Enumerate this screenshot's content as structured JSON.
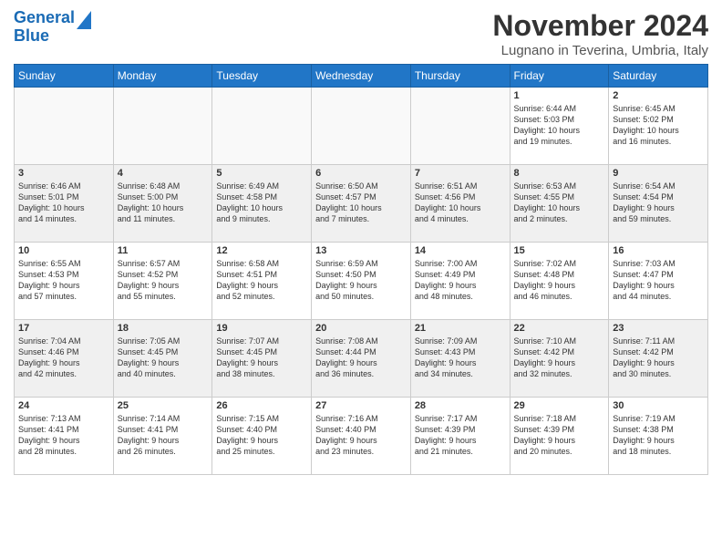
{
  "logo": {
    "line1": "General",
    "line2": "Blue"
  },
  "header": {
    "month": "November 2024",
    "location": "Lugnano in Teverina, Umbria, Italy"
  },
  "weekdays": [
    "Sunday",
    "Monday",
    "Tuesday",
    "Wednesday",
    "Thursday",
    "Friday",
    "Saturday"
  ],
  "weeks": [
    [
      {
        "day": "",
        "content": ""
      },
      {
        "day": "",
        "content": ""
      },
      {
        "day": "",
        "content": ""
      },
      {
        "day": "",
        "content": ""
      },
      {
        "day": "",
        "content": ""
      },
      {
        "day": "1",
        "content": "Sunrise: 6:44 AM\nSunset: 5:03 PM\nDaylight: 10 hours\nand 19 minutes."
      },
      {
        "day": "2",
        "content": "Sunrise: 6:45 AM\nSunset: 5:02 PM\nDaylight: 10 hours\nand 16 minutes."
      }
    ],
    [
      {
        "day": "3",
        "content": "Sunrise: 6:46 AM\nSunset: 5:01 PM\nDaylight: 10 hours\nand 14 minutes."
      },
      {
        "day": "4",
        "content": "Sunrise: 6:48 AM\nSunset: 5:00 PM\nDaylight: 10 hours\nand 11 minutes."
      },
      {
        "day": "5",
        "content": "Sunrise: 6:49 AM\nSunset: 4:58 PM\nDaylight: 10 hours\nand 9 minutes."
      },
      {
        "day": "6",
        "content": "Sunrise: 6:50 AM\nSunset: 4:57 PM\nDaylight: 10 hours\nand 7 minutes."
      },
      {
        "day": "7",
        "content": "Sunrise: 6:51 AM\nSunset: 4:56 PM\nDaylight: 10 hours\nand 4 minutes."
      },
      {
        "day": "8",
        "content": "Sunrise: 6:53 AM\nSunset: 4:55 PM\nDaylight: 10 hours\nand 2 minutes."
      },
      {
        "day": "9",
        "content": "Sunrise: 6:54 AM\nSunset: 4:54 PM\nDaylight: 9 hours\nand 59 minutes."
      }
    ],
    [
      {
        "day": "10",
        "content": "Sunrise: 6:55 AM\nSunset: 4:53 PM\nDaylight: 9 hours\nand 57 minutes."
      },
      {
        "day": "11",
        "content": "Sunrise: 6:57 AM\nSunset: 4:52 PM\nDaylight: 9 hours\nand 55 minutes."
      },
      {
        "day": "12",
        "content": "Sunrise: 6:58 AM\nSunset: 4:51 PM\nDaylight: 9 hours\nand 52 minutes."
      },
      {
        "day": "13",
        "content": "Sunrise: 6:59 AM\nSunset: 4:50 PM\nDaylight: 9 hours\nand 50 minutes."
      },
      {
        "day": "14",
        "content": "Sunrise: 7:00 AM\nSunset: 4:49 PM\nDaylight: 9 hours\nand 48 minutes."
      },
      {
        "day": "15",
        "content": "Sunrise: 7:02 AM\nSunset: 4:48 PM\nDaylight: 9 hours\nand 46 minutes."
      },
      {
        "day": "16",
        "content": "Sunrise: 7:03 AM\nSunset: 4:47 PM\nDaylight: 9 hours\nand 44 minutes."
      }
    ],
    [
      {
        "day": "17",
        "content": "Sunrise: 7:04 AM\nSunset: 4:46 PM\nDaylight: 9 hours\nand 42 minutes."
      },
      {
        "day": "18",
        "content": "Sunrise: 7:05 AM\nSunset: 4:45 PM\nDaylight: 9 hours\nand 40 minutes."
      },
      {
        "day": "19",
        "content": "Sunrise: 7:07 AM\nSunset: 4:45 PM\nDaylight: 9 hours\nand 38 minutes."
      },
      {
        "day": "20",
        "content": "Sunrise: 7:08 AM\nSunset: 4:44 PM\nDaylight: 9 hours\nand 36 minutes."
      },
      {
        "day": "21",
        "content": "Sunrise: 7:09 AM\nSunset: 4:43 PM\nDaylight: 9 hours\nand 34 minutes."
      },
      {
        "day": "22",
        "content": "Sunrise: 7:10 AM\nSunset: 4:42 PM\nDaylight: 9 hours\nand 32 minutes."
      },
      {
        "day": "23",
        "content": "Sunrise: 7:11 AM\nSunset: 4:42 PM\nDaylight: 9 hours\nand 30 minutes."
      }
    ],
    [
      {
        "day": "24",
        "content": "Sunrise: 7:13 AM\nSunset: 4:41 PM\nDaylight: 9 hours\nand 28 minutes."
      },
      {
        "day": "25",
        "content": "Sunrise: 7:14 AM\nSunset: 4:41 PM\nDaylight: 9 hours\nand 26 minutes."
      },
      {
        "day": "26",
        "content": "Sunrise: 7:15 AM\nSunset: 4:40 PM\nDaylight: 9 hours\nand 25 minutes."
      },
      {
        "day": "27",
        "content": "Sunrise: 7:16 AM\nSunset: 4:40 PM\nDaylight: 9 hours\nand 23 minutes."
      },
      {
        "day": "28",
        "content": "Sunrise: 7:17 AM\nSunset: 4:39 PM\nDaylight: 9 hours\nand 21 minutes."
      },
      {
        "day": "29",
        "content": "Sunrise: 7:18 AM\nSunset: 4:39 PM\nDaylight: 9 hours\nand 20 minutes."
      },
      {
        "day": "30",
        "content": "Sunrise: 7:19 AM\nSunset: 4:38 PM\nDaylight: 9 hours\nand 18 minutes."
      }
    ]
  ]
}
